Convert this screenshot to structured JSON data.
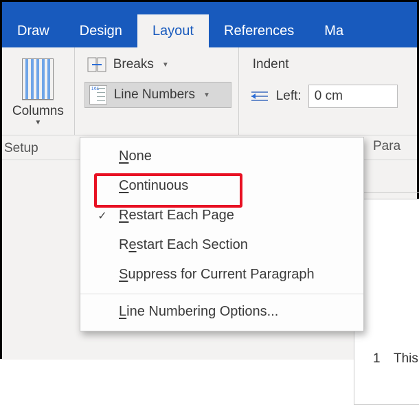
{
  "tabs": {
    "draw": "Draw",
    "design": "Design",
    "layout": "Layout",
    "references": "References",
    "mailings": "Ma"
  },
  "columns": {
    "label": "Columns"
  },
  "setup": {
    "label": "Setup"
  },
  "breaks": {
    "label": "Breaks"
  },
  "line_numbers": {
    "label": "Line Numbers"
  },
  "indent": {
    "title": "Indent",
    "left_label": "Left:",
    "left_value": "0 cm"
  },
  "ruler": {
    "paragraph": "Para"
  },
  "page": {
    "line_no": "1",
    "line_text": "This"
  },
  "menu": {
    "none_pre": "",
    "none_u": "N",
    "none_post": "one",
    "cont_pre": "",
    "cont_u": "C",
    "cont_post": "ontinuous",
    "restart_page_pre": "",
    "restart_page_u": "R",
    "restart_page_post": "estart Each Page",
    "restart_sec_pre": "R",
    "restart_sec_u": "e",
    "restart_sec_post": "start Each Section",
    "suppress_pre": "",
    "suppress_u": "S",
    "suppress_post": "uppress for Current Paragraph",
    "options_pre": "",
    "options_u": "L",
    "options_post": "ine Numbering Options..."
  }
}
